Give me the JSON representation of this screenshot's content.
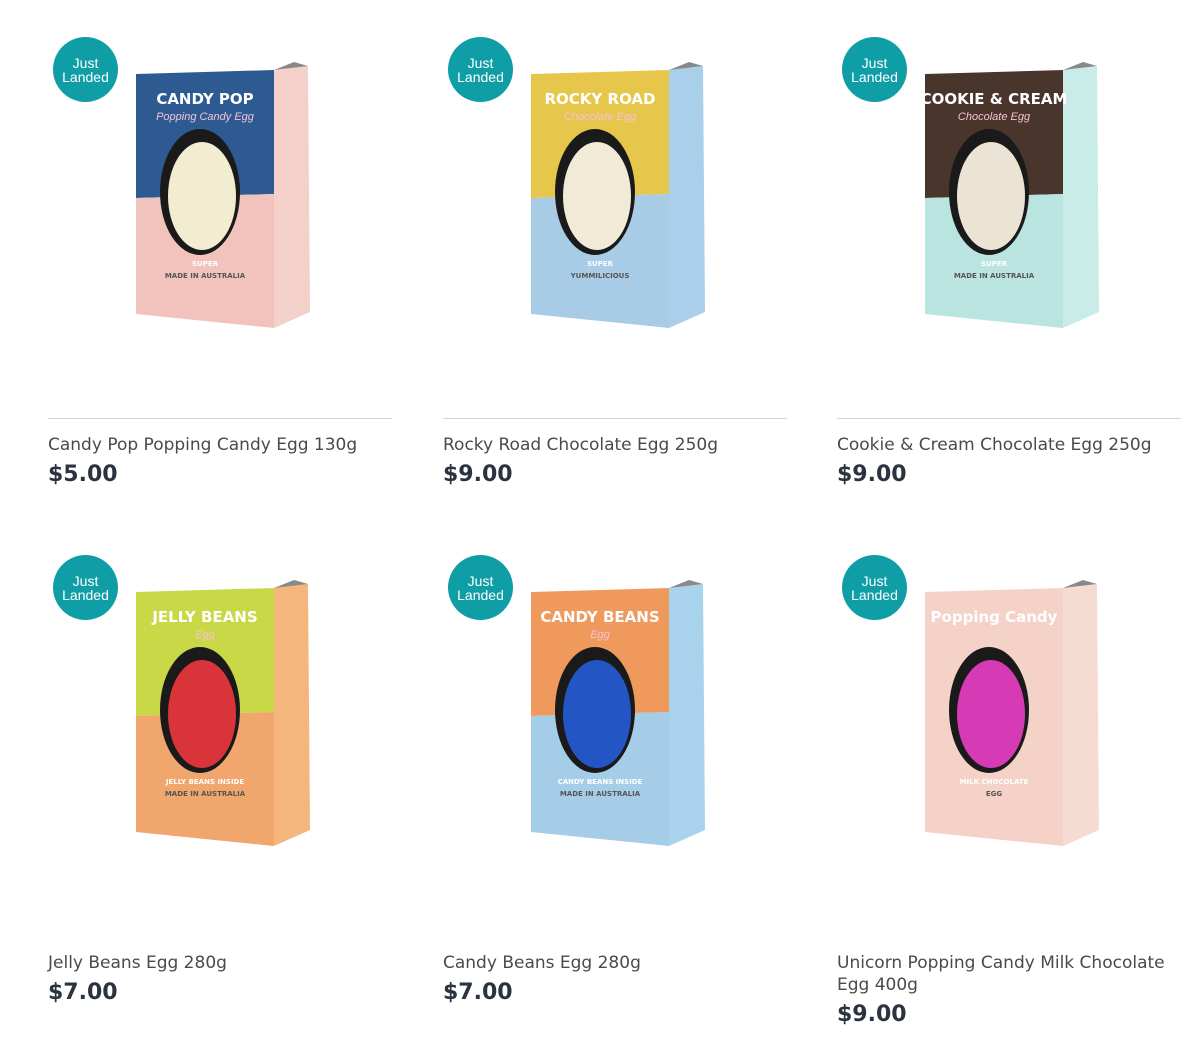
{
  "badge": {
    "line1": "Just",
    "line2": "Landed"
  },
  "products": [
    {
      "title": "Candy Pop Popping Candy Egg 130g",
      "price": "$5.00",
      "box": {
        "brand": "CANDY POP",
        "sub": "Popping Candy Egg",
        "top": "#2e5a92",
        "bottom": "#f2c3bd",
        "side": "#f4d0cb",
        "egg": "#f2edd0",
        "small1": "SUPER",
        "small2": "MADE IN AUSTRALIA"
      }
    },
    {
      "title": "Rocky Road Chocolate Egg 250g",
      "price": "$9.00",
      "box": {
        "brand": "ROCKY ROAD",
        "sub": "Chocolate Egg",
        "top": "#e6c64b",
        "bottom": "#a8cce6",
        "side": "#a9cfea",
        "egg": "#f1ead6",
        "small1": "SUPER",
        "small2": "YUMMILICIOUS"
      }
    },
    {
      "title": "Cookie & Cream Chocolate Egg 250g",
      "price": "$9.00",
      "box": {
        "brand": "COOKIE & CREAM",
        "sub": "Chocolate Egg",
        "top": "#4a352c",
        "bottom": "#b9e4e0",
        "side": "#c9ece8",
        "egg": "#ebe4d4",
        "small1": "SUPER",
        "small2": "MADE IN AUSTRALIA"
      }
    },
    {
      "title": "Jelly Beans Egg 280g",
      "price": "$7.00",
      "box": {
        "brand": "JELLY BEANS",
        "sub": "Egg",
        "top": "#c8d846",
        "bottom": "#f0a66c",
        "side": "#f5b67d",
        "egg": "#d8343a",
        "small1": "JELLY BEANS INSIDE",
        "small2": "MADE IN AUSTRALIA"
      }
    },
    {
      "title": "Candy Beans Egg 280g",
      "price": "$7.00",
      "box": {
        "brand": "CANDY BEANS",
        "sub": "Egg",
        "top": "#ef9a5c",
        "bottom": "#a6cde8",
        "side": "#a9d2ec",
        "egg": "#2455c4",
        "small1": "CANDY BEANS INSIDE",
        "small2": "MADE IN AUSTRALIA"
      }
    },
    {
      "title": "Unicorn Popping Candy Milk Chocolate Egg 400g",
      "price": "$9.00",
      "box": {
        "brand": "Popping Candy",
        "sub": "",
        "top": "#f4d2c8",
        "bottom": "#f4d2c8",
        "side": "#f6dbd2",
        "egg": "#d63ab4",
        "small1": "MILK CHOCOLATE",
        "small2": "EGG"
      }
    }
  ]
}
